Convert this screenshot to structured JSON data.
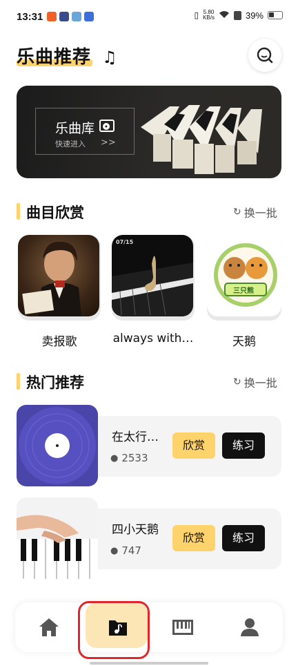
{
  "status_bar": {
    "time": "13:31",
    "net_speed": "5.80",
    "net_unit": "KB/s",
    "battery": "39%"
  },
  "header": {
    "title": "乐曲推荐",
    "title_icon": "music-note-icon",
    "search_icon": "search-icon"
  },
  "banner": {
    "title": "乐曲库",
    "subtitle": "快速进入",
    "arrow": ">>"
  },
  "section_appreciation": {
    "title": "曲目欣赏",
    "refresh_label": "换一批",
    "items": [
      {
        "label": "卖报歌"
      },
      {
        "label": "always with…",
        "date_tag": "07/15"
      },
      {
        "label": "天鹅",
        "badge_text": "三只熊"
      }
    ]
  },
  "section_hot": {
    "title": "热门推荐",
    "refresh_label": "换一批",
    "items": [
      {
        "title": "在太行…",
        "count": "2533",
        "appreciate_label": "欣赏",
        "practice_label": "练习"
      },
      {
        "title": "四小天鹅",
        "count": "747",
        "appreciate_label": "欣赏",
        "practice_label": "练习"
      }
    ]
  },
  "tab_bar": {
    "tabs": [
      {
        "name": "home",
        "icon": "home-icon"
      },
      {
        "name": "music-folder",
        "icon": "music-folder-icon",
        "active": true
      },
      {
        "name": "piano",
        "icon": "piano-keys-icon"
      },
      {
        "name": "profile",
        "icon": "person-icon"
      }
    ]
  },
  "colors": {
    "accent": "#FFD36B",
    "active_tab_bg": "#FCE6B6",
    "highlight_outline": "#e0252c",
    "dark_button": "#111111"
  }
}
